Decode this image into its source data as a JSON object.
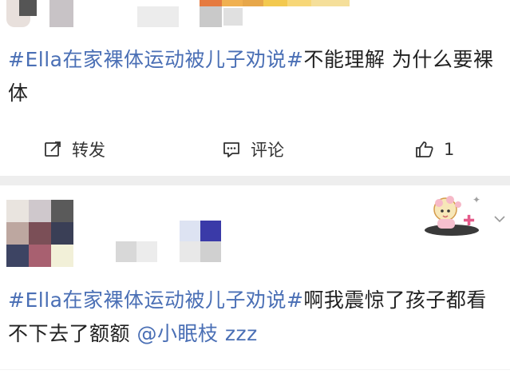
{
  "post1": {
    "hashtag": "#Ella在家裸体运动被儿子劝说#",
    "text": "不能理解 为什么要裸体",
    "actions": {
      "repost_label": "转发",
      "comment_label": "评论",
      "like_count": "1"
    }
  },
  "post2": {
    "hashtag": "#Ella在家裸体运动被儿子劝说#",
    "text": "啊我震惊了孩子都看不下去了额额",
    "mention": "@小眠枝",
    "suffix": " zzz"
  },
  "icons": {
    "repost": "share-edit-icon",
    "comment": "comment-icon",
    "like": "thumbs-up-icon",
    "more": "chevron-down-icon"
  },
  "colors": {
    "hashtag": "#4a6fb5",
    "text": "#222222",
    "divider": "#eeeeee"
  }
}
